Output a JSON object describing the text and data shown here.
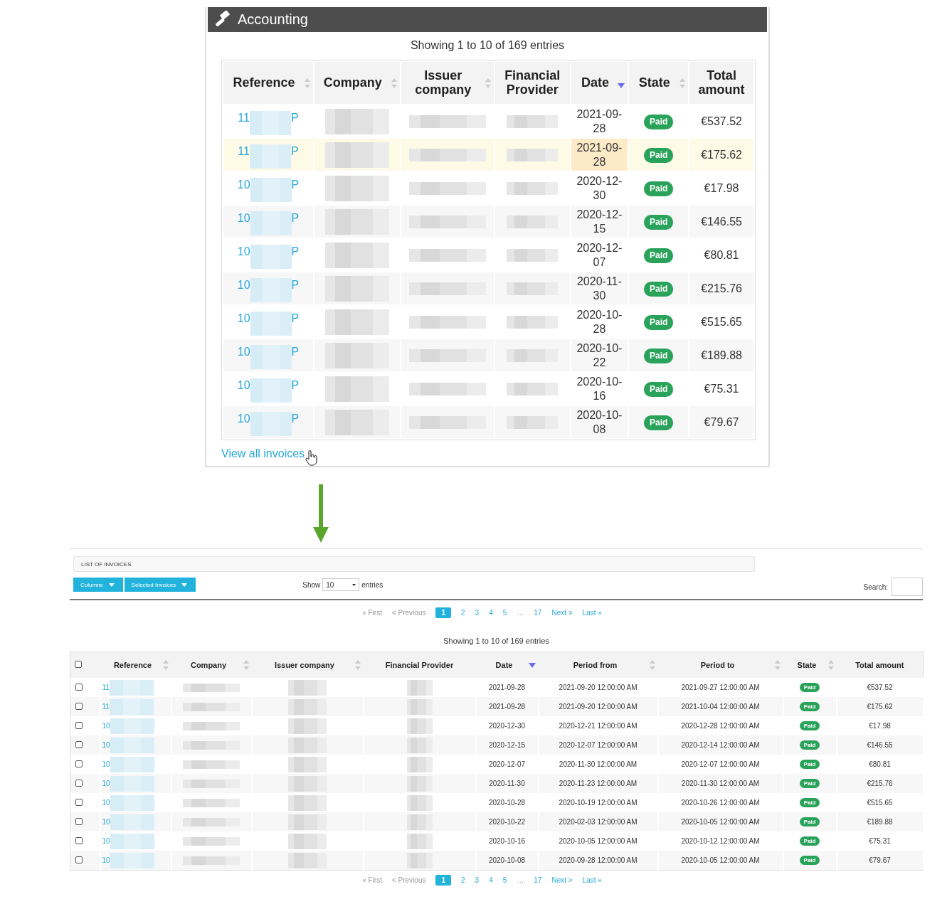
{
  "panel": {
    "title": "Accounting",
    "info": "Showing 1 to 10 of 169 entries",
    "columns": [
      {
        "label": "Reference",
        "sortable": true,
        "sorted": false
      },
      {
        "label": "Company",
        "sortable": true,
        "sorted": false
      },
      {
        "label": "Issuer company",
        "sortable": true,
        "sorted": false
      },
      {
        "label": "Financial Provider",
        "sortable": false,
        "sorted": false
      },
      {
        "label": "Date",
        "sortable": true,
        "sorted": true
      },
      {
        "label": "State",
        "sortable": true,
        "sorted": false
      },
      {
        "label": "Total amount",
        "sortable": false,
        "sorted": false
      }
    ],
    "rows": [
      {
        "reference_start": "11",
        "reference_end": "P",
        "date": "2021-09-28",
        "state": "Paid",
        "total": "€537.52",
        "highlighted": false
      },
      {
        "reference_start": "11",
        "reference_end": "P",
        "date": "2021-09-28",
        "state": "Paid",
        "total": "€175.62",
        "highlighted": true
      },
      {
        "reference_start": "10",
        "reference_end": "P",
        "date": "2020-12-30",
        "state": "Paid",
        "total": "€17.98",
        "highlighted": false
      },
      {
        "reference_start": "10",
        "reference_end": "P",
        "date": "2020-12-15",
        "state": "Paid",
        "total": "€146.55",
        "highlighted": false
      },
      {
        "reference_start": "10",
        "reference_end": "P",
        "date": "2020-12-07",
        "state": "Paid",
        "total": "€80.81",
        "highlighted": false
      },
      {
        "reference_start": "10",
        "reference_end": "P",
        "date": "2020-11-30",
        "state": "Paid",
        "total": "€215.76",
        "highlighted": false
      },
      {
        "reference_start": "10",
        "reference_end": "P",
        "date": "2020-10-28",
        "state": "Paid",
        "total": "€515.65",
        "highlighted": false
      },
      {
        "reference_start": "10",
        "reference_end": "P",
        "date": "2020-10-22",
        "state": "Paid",
        "total": "€189.88",
        "highlighted": false
      },
      {
        "reference_start": "10",
        "reference_end": "P",
        "date": "2020-10-16",
        "state": "Paid",
        "total": "€75.31",
        "highlighted": false
      },
      {
        "reference_start": "10",
        "reference_end": "P",
        "date": "2020-10-08",
        "state": "Paid",
        "total": "€79.67",
        "highlighted": false
      }
    ],
    "link": "View all invoices"
  },
  "invoice_list": {
    "title": "LIST OF INVOICES",
    "buttons": [
      "Columns",
      "Selected Invoices"
    ],
    "show_label": "Show",
    "page_size": "10",
    "entries_label": "entries",
    "search_label": "Search:",
    "pagination_top": [
      {
        "label": "« First",
        "selected": false,
        "disabled": true
      },
      {
        "label": "< Previous",
        "selected": false,
        "disabled": true
      },
      {
        "label": "1",
        "selected": true,
        "disabled": false
      },
      {
        "label": "2",
        "selected": false,
        "disabled": false
      },
      {
        "label": "3",
        "selected": false,
        "disabled": false
      },
      {
        "label": "4",
        "selected": false,
        "disabled": false
      },
      {
        "label": "5",
        "selected": false,
        "disabled": false
      },
      {
        "label": "…",
        "selected": false,
        "disabled": true
      },
      {
        "label": "17",
        "selected": false,
        "disabled": false
      },
      {
        "label": "Next >",
        "selected": false,
        "disabled": false
      },
      {
        "label": "Last »",
        "selected": false,
        "disabled": false
      }
    ],
    "info": "Showing 1 to 10 of 169 entries",
    "select_all_checked": false,
    "columns": [
      {
        "label": "Reference",
        "sortable": true,
        "sorted": false
      },
      {
        "label": "Company",
        "sortable": true,
        "sorted": false
      },
      {
        "label": "Issuer company",
        "sortable": true,
        "sorted": false
      },
      {
        "label": "Financial Provider",
        "sortable": false,
        "sorted": false
      },
      {
        "label": "Date",
        "sortable": true,
        "sorted": true
      },
      {
        "label": "Period from",
        "sortable": true,
        "sorted": false
      },
      {
        "label": "Period to",
        "sortable": true,
        "sorted": false
      },
      {
        "label": "State",
        "sortable": true,
        "sorted": false
      },
      {
        "label": "Total amount",
        "sortable": false,
        "sorted": false
      }
    ],
    "rows": [
      {
        "checked": false,
        "reference": "11",
        "date": "2021-09-28",
        "period_from": "2021-09-20 12:00:00 AM",
        "period_to": "2021-09-27 12:00:00 AM",
        "state": "Paid",
        "total": "€537.52"
      },
      {
        "checked": false,
        "reference": "11",
        "date": "2021-09-28",
        "period_from": "2021-09-20 12:00:00 AM",
        "period_to": "2021-10-04 12:00:00 AM",
        "state": "Paid",
        "total": "€175.62"
      },
      {
        "checked": false,
        "reference": "10",
        "date": "2020-12-30",
        "period_from": "2020-12-21 12:00:00 AM",
        "period_to": "2020-12-28 12:00:00 AM",
        "state": "Paid",
        "total": "€17.98"
      },
      {
        "checked": false,
        "reference": "10",
        "date": "2020-12-15",
        "period_from": "2020-12-07 12:00:00 AM",
        "period_to": "2020-12-14 12:00:00 AM",
        "state": "Paid",
        "total": "€146.55"
      },
      {
        "checked": false,
        "reference": "10",
        "date": "2020-12-07",
        "period_from": "2020-11-30 12:00:00 AM",
        "period_to": "2020-12-07 12:00:00 AM",
        "state": "Paid",
        "total": "€80.81"
      },
      {
        "checked": false,
        "reference": "10",
        "date": "2020-11-30",
        "period_from": "2020-11-23 12:00:00 AM",
        "period_to": "2020-11-30 12:00:00 AM",
        "state": "Paid",
        "total": "€215.76"
      },
      {
        "checked": false,
        "reference": "10",
        "date": "2020-10-28",
        "period_from": "2020-10-19 12:00:00 AM",
        "period_to": "2020-10-26 12:00:00 AM",
        "state": "Paid",
        "total": "€515.65"
      },
      {
        "checked": false,
        "reference": "10",
        "date": "2020-10-22",
        "period_from": "2020-02-03 12:00:00 AM",
        "period_to": "2020-10-05 12:00:00 AM",
        "state": "Paid",
        "total": "€189.88"
      },
      {
        "checked": false,
        "reference": "10",
        "date": "2020-10-16",
        "period_from": "2020-10-05 12:00:00 AM",
        "period_to": "2020-10-12 12:00:00 AM",
        "state": "Paid",
        "total": "€75.31"
      },
      {
        "checked": false,
        "reference": "10",
        "date": "2020-10-08",
        "period_from": "2020-09-28 12:00:00 AM",
        "period_to": "2020-10-05 12:00:00 AM",
        "state": "Paid",
        "total": "€79.67"
      }
    ],
    "pagination_bottom": [
      {
        "label": "« First",
        "selected": false,
        "disabled": true
      },
      {
        "label": "< Previous",
        "selected": false,
        "disabled": true
      },
      {
        "label": "1",
        "selected": true,
        "disabled": false
      },
      {
        "label": "2",
        "selected": false,
        "disabled": false
      },
      {
        "label": "3",
        "selected": false,
        "disabled": false
      },
      {
        "label": "4",
        "selected": false,
        "disabled": false
      },
      {
        "label": "5",
        "selected": false,
        "disabled": false
      },
      {
        "label": "…",
        "selected": false,
        "disabled": true
      },
      {
        "label": "17",
        "selected": false,
        "disabled": false
      },
      {
        "label": "Next >",
        "selected": false,
        "disabled": false
      },
      {
        "label": "Last »",
        "selected": false,
        "disabled": false
      }
    ]
  }
}
